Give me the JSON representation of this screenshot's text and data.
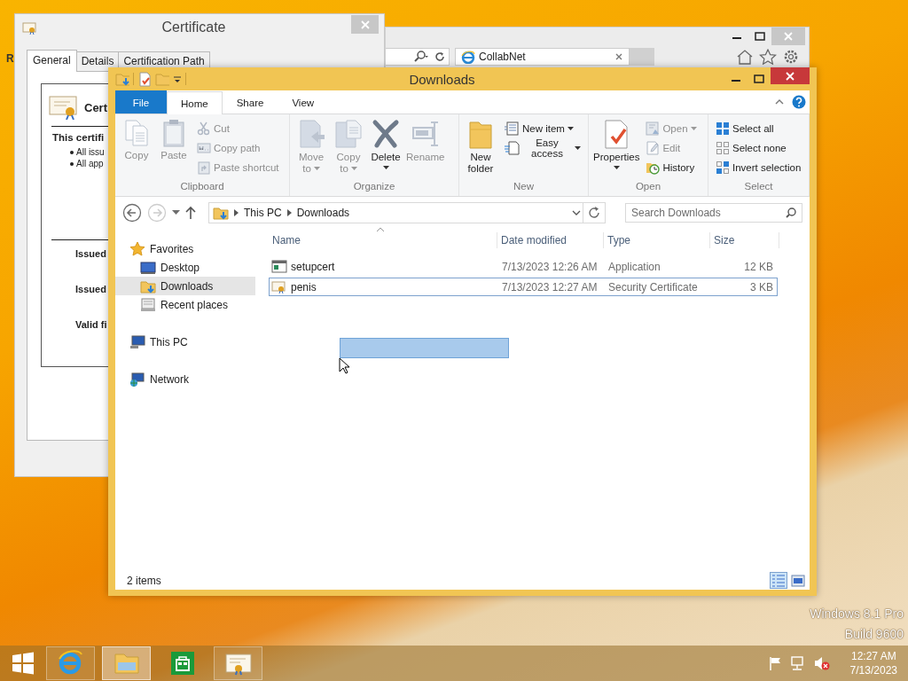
{
  "desktop": {
    "edge_text": "R",
    "branding": [
      "Windows 8.1 Pro",
      "Build 9600"
    ]
  },
  "certificate_window": {
    "title": "Certificate",
    "tabs": [
      {
        "label": "General",
        "selected": true
      },
      {
        "label": "Details",
        "selected": false
      },
      {
        "label": "Certification Path",
        "selected": false
      }
    ],
    "heading": "Cert",
    "statement": "This certifi",
    "bullets": [
      "All issu",
      "All app"
    ],
    "field_labels": [
      "Issued",
      "Issued",
      "Valid fi"
    ]
  },
  "browser_window": {
    "tab_title": "CollabNet"
  },
  "explorer": {
    "title": "Downloads",
    "ribbon_tabs": [
      {
        "label": "File",
        "kind": "menu",
        "selected": false
      },
      {
        "label": "Home",
        "kind": "tab",
        "selected": true
      },
      {
        "label": "Share",
        "kind": "tab",
        "selected": false
      },
      {
        "label": "View",
        "kind": "tab",
        "selected": false
      }
    ],
    "ribbon_groups": [
      {
        "name": "Clipboard",
        "items": [
          {
            "lines": [
              "Copy"
            ],
            "kind": "large",
            "disabled": true,
            "dropdown": false
          },
          {
            "lines": [
              "Paste"
            ],
            "kind": "large",
            "disabled": true,
            "dropdown": false
          },
          {
            "lines": [
              "Cut"
            ],
            "kind": "small",
            "disabled": true,
            "dropdown": false
          },
          {
            "lines": [
              "Copy path"
            ],
            "kind": "small",
            "disabled": true,
            "dropdown": false
          },
          {
            "lines": [
              "Paste shortcut"
            ],
            "kind": "small",
            "disabled": true,
            "dropdown": false
          }
        ]
      },
      {
        "name": "Organize",
        "items": [
          {
            "lines": [
              "Move",
              "to"
            ],
            "kind": "large",
            "disabled": true,
            "dropdown": true
          },
          {
            "lines": [
              "Copy",
              "to"
            ],
            "kind": "large",
            "disabled": true,
            "dropdown": true
          },
          {
            "lines": [
              "Delete"
            ],
            "kind": "large",
            "disabled": false,
            "dropdown": true
          },
          {
            "lines": [
              "Rename"
            ],
            "kind": "large",
            "disabled": true,
            "dropdown": false
          }
        ]
      },
      {
        "name": "New",
        "items": [
          {
            "lines": [
              "New",
              "folder"
            ],
            "kind": "large",
            "disabled": false,
            "dropdown": false
          },
          {
            "lines": [
              "New item"
            ],
            "kind": "small",
            "disabled": false,
            "dropdown": true
          },
          {
            "lines": [
              "Easy access"
            ],
            "kind": "small",
            "disabled": false,
            "dropdown": true
          }
        ]
      },
      {
        "name": "Open",
        "items": [
          {
            "lines": [
              "Properties"
            ],
            "kind": "large",
            "disabled": false,
            "dropdown": true
          },
          {
            "lines": [
              "Open"
            ],
            "kind": "small",
            "disabled": true,
            "dropdown": true
          },
          {
            "lines": [
              "Edit"
            ],
            "kind": "small",
            "disabled": true,
            "dropdown": false
          },
          {
            "lines": [
              "History"
            ],
            "kind": "small",
            "disabled": false,
            "dropdown": false
          }
        ]
      },
      {
        "name": "Select",
        "items": [
          {
            "lines": [
              "Select all"
            ],
            "kind": "small",
            "disabled": false,
            "dropdown": false
          },
          {
            "lines": [
              "Select none"
            ],
            "kind": "small",
            "disabled": false,
            "dropdown": false
          },
          {
            "lines": [
              "Invert selection"
            ],
            "kind": "small",
            "disabled": false,
            "dropdown": false
          }
        ]
      }
    ],
    "path": [
      "This PC",
      "Downloads"
    ],
    "search": {
      "placeholder": "Search Downloads"
    },
    "navigation": [
      {
        "label": "Favorites",
        "selected": false,
        "children": [
          {
            "label": "Desktop",
            "selected": false
          },
          {
            "label": "Downloads",
            "selected": true
          },
          {
            "label": "Recent places",
            "selected": false
          }
        ]
      },
      {
        "label": "This PC",
        "selected": false
      },
      {
        "label": "Network",
        "selected": false
      }
    ],
    "columns": [
      "Name",
      "Date modified",
      "Type",
      "Size"
    ],
    "files": [
      {
        "name": "setupcert",
        "date": "7/13/2023 12:26 AM",
        "type": "Application",
        "size": "12 KB",
        "selected": false
      },
      {
        "name": "penis",
        "date": "7/13/2023 12:27 AM",
        "type": "Security Certificate",
        "size": "3 KB",
        "selected": true
      }
    ],
    "status": "2 items",
    "view_buttons": [
      {
        "selected": true
      },
      {
        "selected": false
      }
    ]
  },
  "taskbar": {
    "apps": [
      {
        "running": true,
        "selected": false
      },
      {
        "running": true,
        "selected": true
      },
      {
        "running": false,
        "selected": false
      },
      {
        "running": true,
        "selected": false
      }
    ],
    "clock": {
      "time": "12:27 AM",
      "date": "7/13/2023"
    }
  }
}
